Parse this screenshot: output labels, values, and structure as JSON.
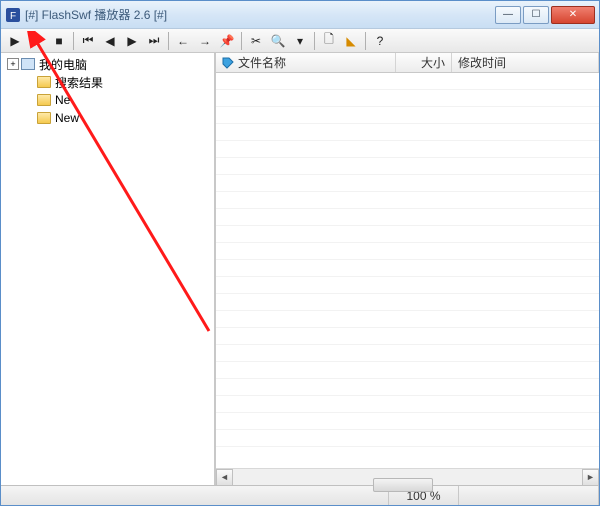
{
  "title": "[#] FlashSwf 播放器 2.6 [#]",
  "tree": {
    "root": {
      "label": "我的电脑"
    },
    "children": [
      {
        "label": "搜索结果"
      },
      {
        "label": "Ne"
      },
      {
        "label": "New"
      }
    ]
  },
  "columns": {
    "name": "文件名称",
    "size": "大小",
    "mtime": "修改时间"
  },
  "status": {
    "zoom": "100 %"
  },
  "toolbar_icons": {
    "play": "▶",
    "dropdown": "▾",
    "stop": "■",
    "first": "⏮",
    "prev": "◀",
    "next": "▶",
    "last": "⏭",
    "left": "←",
    "right": "→",
    "pin": "📌",
    "cut": "✂",
    "find": "🔍",
    "find_dd": "▾",
    "newdoc": "🗋",
    "tag": "◣",
    "help": "?"
  },
  "win": {
    "min": "—",
    "max": "☐",
    "close": "✕"
  }
}
